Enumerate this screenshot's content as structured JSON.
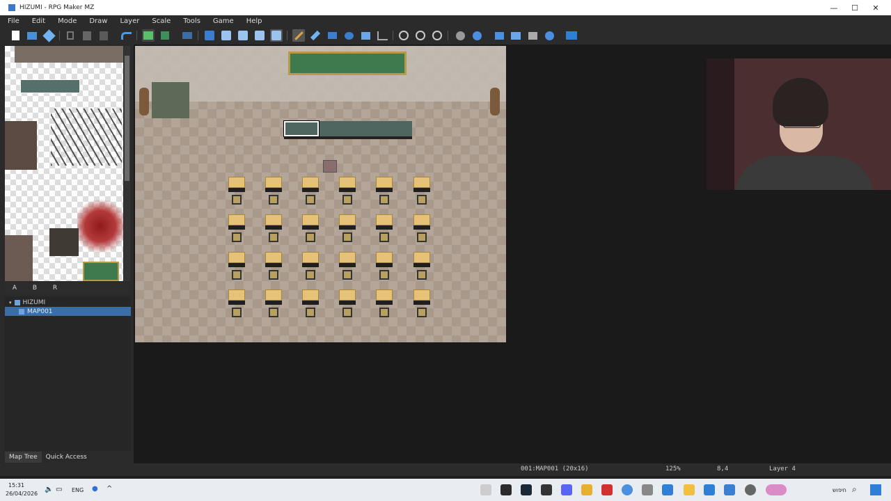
{
  "window": {
    "title": "HIZUMI - RPG Maker MZ",
    "minimize_glyph": "—",
    "maximize_glyph": "☐",
    "close_glyph": "✕"
  },
  "menu": [
    "File",
    "Edit",
    "Mode",
    "Draw",
    "Layer",
    "Scale",
    "Tools",
    "Game",
    "Help"
  ],
  "toolbar": {
    "icons": [
      "new-project-icon",
      "open-project-icon",
      "save-project-icon",
      "cut-icon",
      "copy-icon",
      "paste-icon",
      "undo-icon",
      "map-mode-icon",
      "event-mode-icon",
      "region-mode-icon",
      "layer-auto-icon",
      "layer-1-icon",
      "layer-2-icon",
      "layer-3-icon",
      "layer-4-icon",
      "pencil-icon",
      "eraser-icon",
      "rectangle-icon",
      "ellipse-icon",
      "fill-icon",
      "shadow-pen-icon",
      "zoom-in-icon",
      "zoom-out-icon",
      "zoom-actual-icon",
      "database-icon",
      "plugin-manager-icon",
      "sound-test-icon",
      "event-searcher-icon",
      "character-generator-icon",
      "resource-manager-icon",
      "playtest-icon"
    ]
  },
  "tileset_tabs": [
    "A",
    "B",
    "R"
  ],
  "map_tree": {
    "project": "HIZUMI",
    "maps": [
      "MAP001"
    ]
  },
  "bottom_tabs": [
    "Map Tree",
    "Quick Access"
  ],
  "status": {
    "map_info": "001:MAP001 (20x16)",
    "zoom": "125%",
    "coords": "8,4",
    "layer": "Layer 4"
  },
  "taskbar": {
    "time": "15:31",
    "date": "26/04/2026",
    "lang": "ENG",
    "search_text": "חיפוש"
  },
  "colors": {
    "selection": "#3a6ea5",
    "chalkboard": "#3f7a4e",
    "desk_top": "#e5c277"
  }
}
